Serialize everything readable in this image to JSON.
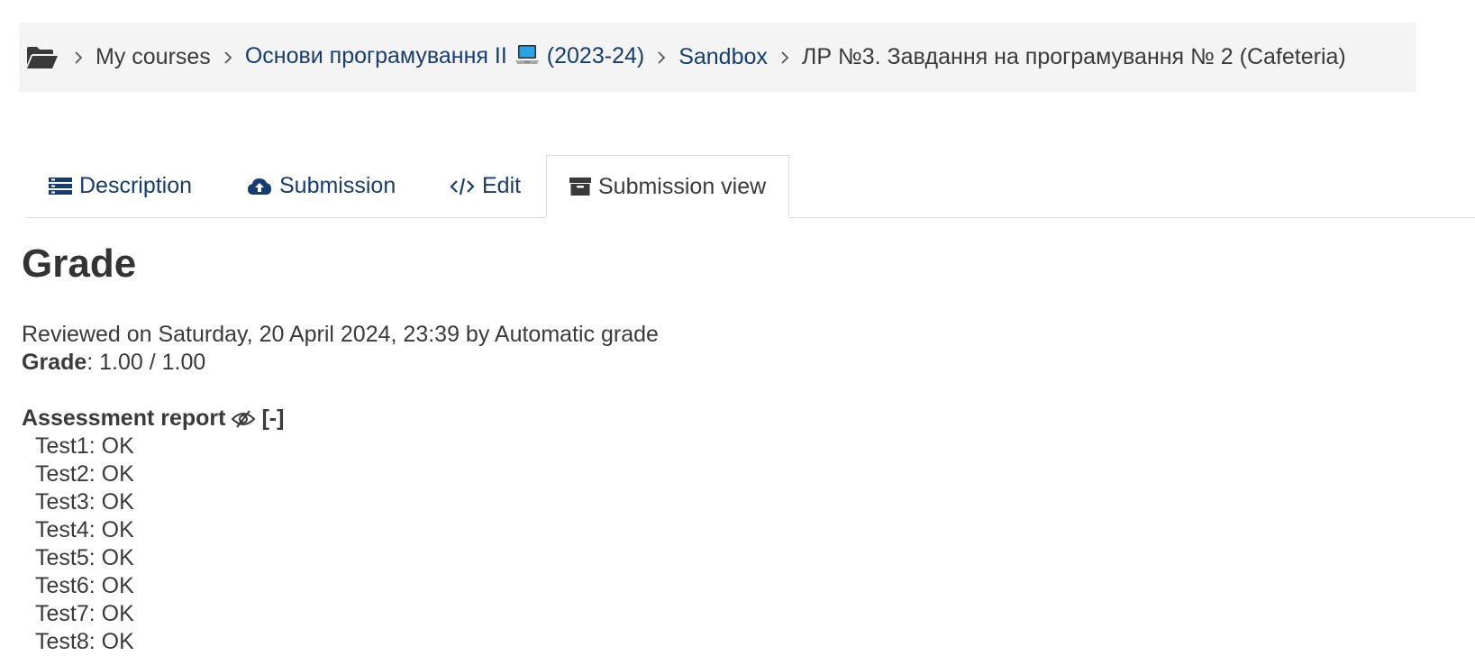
{
  "breadcrumb": {
    "home_icon": "folder-open-icon",
    "items": [
      {
        "label": "My courses"
      },
      {
        "label_before": "Основи програмування II",
        "icon": "laptop-icon",
        "label_after": "(2023-24)"
      },
      {
        "label": "Sandbox"
      },
      {
        "label": "ЛР №3. Завдання на програмування № 2 (Cafeteria)"
      }
    ]
  },
  "tabs": [
    {
      "label": "Description",
      "icon": "list-icon"
    },
    {
      "label": "Submission",
      "icon": "cloud-upload-icon"
    },
    {
      "label": "Edit",
      "icon": "code-icon"
    },
    {
      "label": "Submission view",
      "icon": "archive-icon",
      "active": true
    }
  ],
  "grade_section": {
    "title": "Grade",
    "reviewed": "Reviewed on Saturday, 20 April 2024, 23:39 by Automatic grade",
    "grade_label": "Grade",
    "grade_value": ": 1.00 / 1.00"
  },
  "assessment_report": {
    "title": "Assessment report",
    "eye_icon": "eye-slash-icon",
    "toggle": "[-]",
    "tests": [
      "Test1: OK",
      "Test2: OK",
      "Test3: OK",
      "Test4: OK",
      "Test5: OK",
      "Test6: OK",
      "Test7: OK",
      "Test8: OK"
    ]
  },
  "colors": {
    "link": "#163d73",
    "text": "#3a3a3a",
    "breadcrumb_bg": "#f4f4f4"
  }
}
